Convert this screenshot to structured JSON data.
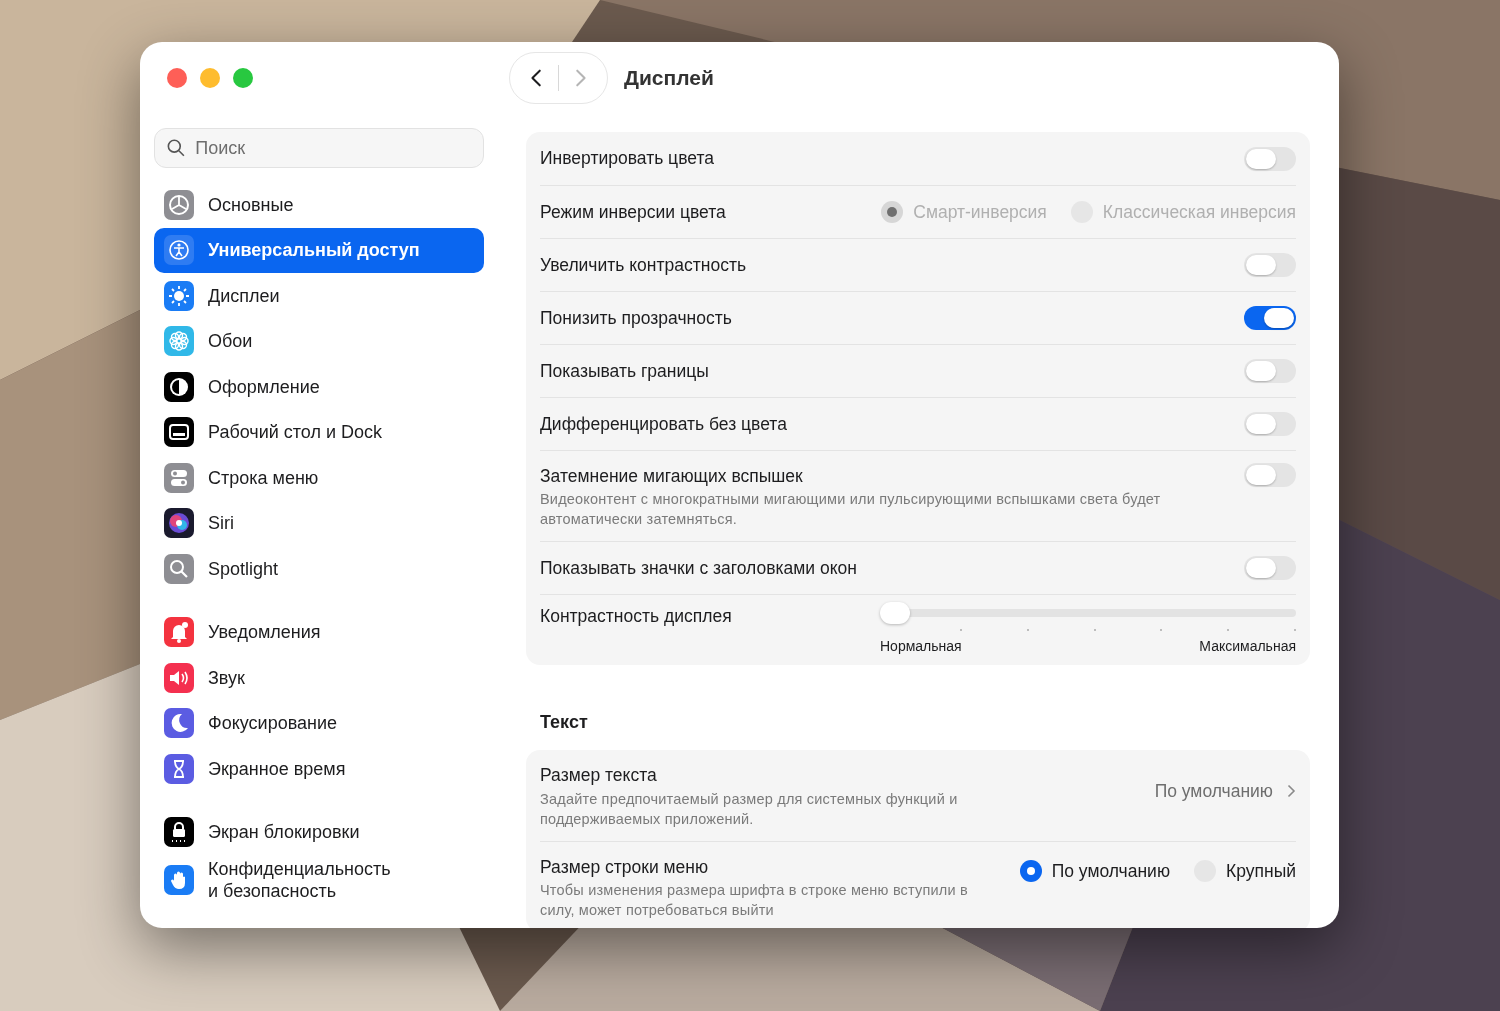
{
  "window": {
    "title": "Дисплей"
  },
  "navigation": [
    {
      "kind": "back",
      "disabled": false
    },
    {
      "kind": "forward",
      "disabled": true
    }
  ],
  "search": {
    "placeholder": "Поиск"
  },
  "sidebar": {
    "groups": [
      {
        "items": [
          {
            "label": "Основные",
            "selected": false
          },
          {
            "label": "Универсальный доступ",
            "selected": true
          },
          {
            "label": "Дисплеи",
            "selected": false
          },
          {
            "label": "Обои",
            "selected": false
          },
          {
            "label": "Оформление",
            "selected": false
          },
          {
            "label": "Рабочий стол и Dock",
            "selected": false
          },
          {
            "label": "Строка меню",
            "selected": false
          },
          {
            "label": "Siri",
            "selected": false
          },
          {
            "label": "Spotlight",
            "selected": false
          }
        ]
      },
      {
        "items": [
          {
            "label": "Уведомления",
            "selected": false
          },
          {
            "label": "Звук",
            "selected": false
          },
          {
            "label": "Фокусирование",
            "selected": false
          },
          {
            "label": "Экранное время",
            "selected": false
          }
        ]
      },
      {
        "items": [
          {
            "label": "Экран блокировки",
            "selected": false
          },
          {
            "label": "Конфиденциальность и безопасность",
            "selected": false
          }
        ]
      }
    ]
  },
  "sections": [
    {
      "rows": [
        {
          "kind": "toggle",
          "label": "Инвертировать цвета",
          "on": false
        },
        {
          "kind": "radio",
          "label": "Режим инверсии цвета",
          "disabled": true,
          "options": [
            {
              "label": "Смарт-инверсия",
              "selected": true
            },
            {
              "label": "Классическая инверсия",
              "selected": false
            }
          ]
        },
        {
          "kind": "toggle",
          "label": "Увеличить контрастность",
          "on": false
        },
        {
          "kind": "toggle",
          "label": "Понизить прозрачность",
          "on": true
        },
        {
          "kind": "toggle",
          "label": "Показывать границы",
          "on": false
        },
        {
          "kind": "toggle",
          "label": "Дифференцировать без цвета",
          "on": false
        },
        {
          "kind": "toggle",
          "label": "Затемнение мигающих вспышек",
          "description": "Видеоконтент с многократными мигающими или пульсирующими вспышками света будет автоматически затемняться.",
          "on": false
        },
        {
          "kind": "toggle",
          "label": "Показывать значки с заголовками окон",
          "on": false
        },
        {
          "kind": "slider",
          "label": "Контрастность дисплея",
          "level": 0,
          "min_label": "Нормальная",
          "max_label": "Максимальная"
        }
      ]
    },
    {
      "title": "Текст",
      "rows": [
        {
          "kind": "value",
          "label": "Размер текста",
          "description": "Задайте предпочитаемый размер для системных функций и поддерживаемых приложений.",
          "value": "По умолчанию"
        },
        {
          "kind": "radio",
          "label": "Размер строки меню",
          "description": "Чтобы изменения размера шрифта в строке меню вступили в силу, может потребоваться выйти",
          "disabled": false,
          "options": [
            {
              "label": "По умолчанию",
              "selected": true
            },
            {
              "label": "Крупный",
              "selected": false
            }
          ]
        }
      ]
    }
  ]
}
